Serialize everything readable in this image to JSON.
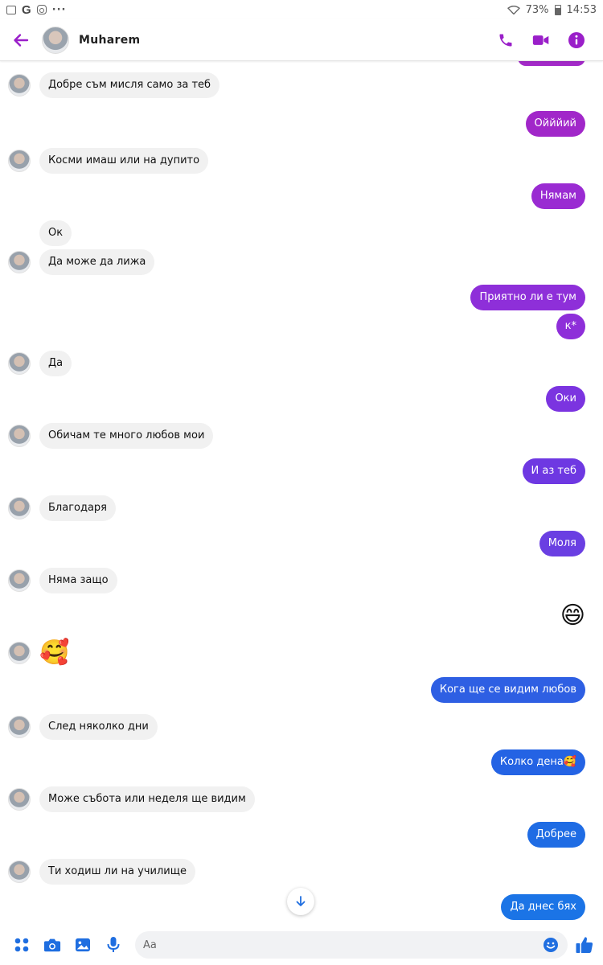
{
  "status_bar": {
    "battery": "73%",
    "time": "14:53",
    "more": "···"
  },
  "header": {
    "contact_name": "Muharem"
  },
  "colors": {
    "accent": "#9a1fc9",
    "purple": "#a32ac8",
    "violet": "#6f35e0",
    "blue": "#1f6ee0",
    "incoming_bg": "#f1f1f1"
  },
  "messages": [
    {
      "side": "in",
      "text": "Добре съм мисля само за теб",
      "avatar": true
    },
    {
      "side": "out",
      "text": "Ойййий",
      "color": "#a127c9"
    },
    {
      "side": "in",
      "text": "Косми имаш или на дупито",
      "avatar": true
    },
    {
      "side": "out",
      "text": "Нямам",
      "color": "#9a2bd2"
    },
    {
      "side": "in",
      "text": "Ок",
      "avatar": false
    },
    {
      "side": "in",
      "text": "Да може да лижа",
      "avatar": true
    },
    {
      "side": "out",
      "text": "Приятно ли е тум",
      "color": "#8e2fd9"
    },
    {
      "side": "out",
      "text": "к*",
      "color": "#8e2fd9"
    },
    {
      "side": "in",
      "text": "Да",
      "avatar": true
    },
    {
      "side": "out",
      "text": "Оки",
      "color": "#7b34e0"
    },
    {
      "side": "in",
      "text": "Обичам те много любов мои",
      "avatar": true
    },
    {
      "side": "out",
      "text": "И аз теб",
      "color": "#6e38e2"
    },
    {
      "side": "in",
      "text": "Благодаря",
      "avatar": true
    },
    {
      "side": "out",
      "text": "Моля",
      "color": "#6a3fe2"
    },
    {
      "side": "in",
      "text": "Няма защо",
      "avatar": true
    },
    {
      "side": "out",
      "text": "😄",
      "emoji": true
    },
    {
      "side": "in",
      "text": "🥰",
      "avatar": true,
      "emoji": true
    },
    {
      "side": "out",
      "text": "Кога ще се видим любов",
      "color": "#2e5fe3"
    },
    {
      "side": "in",
      "text": "След няколко дни",
      "avatar": true
    },
    {
      "side": "out",
      "text": "Колко дена🥰",
      "color": "#2463e4"
    },
    {
      "side": "in",
      "text": "Може събота или неделя ще видим",
      "avatar": true
    },
    {
      "side": "out",
      "text": "Добрее",
      "color": "#1f6ce4"
    },
    {
      "side": "in",
      "text": "Ти ходиш ли на училище",
      "avatar": true
    },
    {
      "side": "out",
      "text": "Да днес бях",
      "color": "#1b74e6"
    }
  ],
  "composer": {
    "placeholder": "Aa"
  },
  "icons": {
    "back": "arrow-left-icon",
    "call": "phone-icon",
    "video": "video-camera-icon",
    "info": "info-icon",
    "menu": "grid-icon",
    "camera": "camera-icon",
    "gallery": "image-icon",
    "mic": "microphone-icon",
    "emoji": "smiley-icon",
    "like": "thumbs-up-icon",
    "scroll": "arrow-down-icon"
  }
}
